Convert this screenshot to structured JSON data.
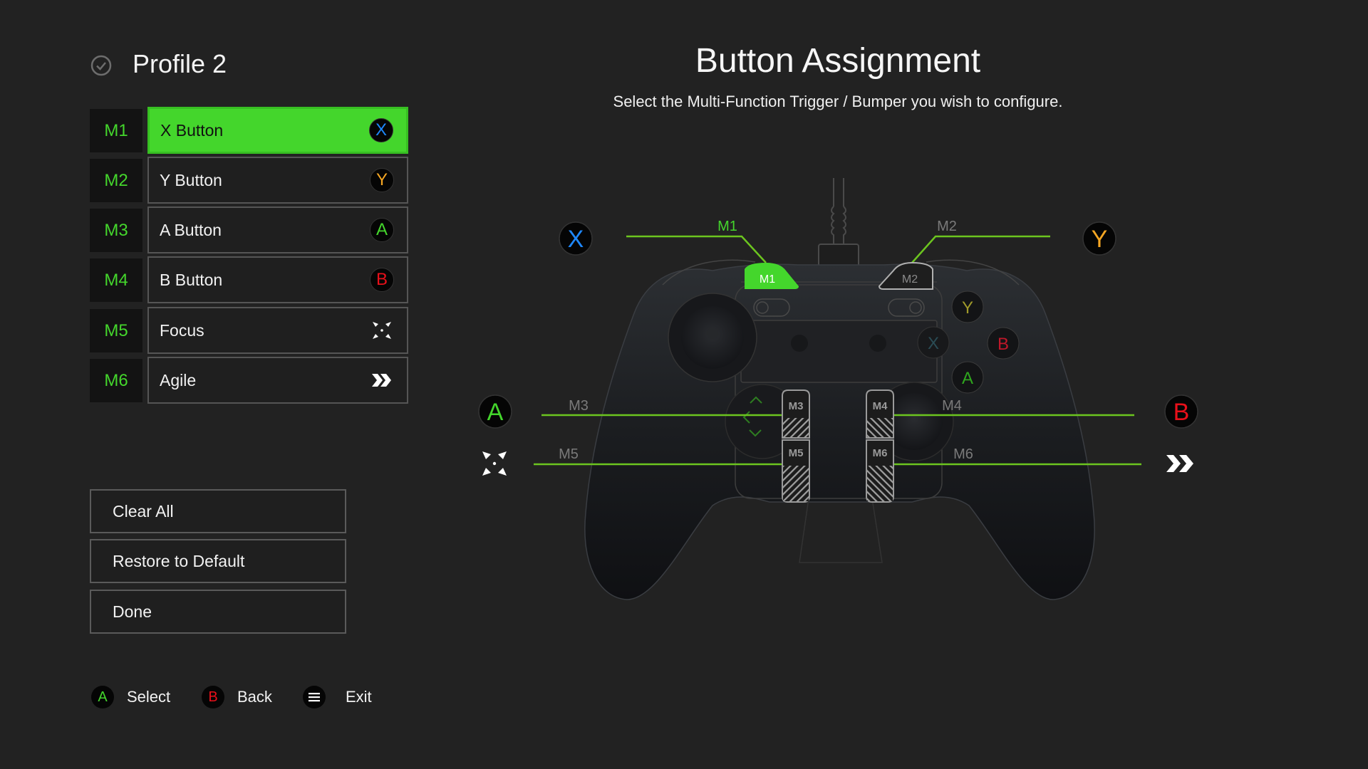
{
  "header": {
    "profile_name": "Profile 2",
    "status_icon": "check-circle-icon"
  },
  "mappings": [
    {
      "slot": "M1",
      "label": "X Button",
      "icon": "x-button-icon",
      "glyph": "X",
      "glyph_color": "#1e88ff",
      "selected": true
    },
    {
      "slot": "M2",
      "label": "Y Button",
      "icon": "y-button-icon",
      "glyph": "Y",
      "glyph_color": "#f5a623",
      "selected": false
    },
    {
      "slot": "M3",
      "label": "A Button",
      "icon": "a-button-icon",
      "glyph": "A",
      "glyph_color": "#44d62c",
      "selected": false
    },
    {
      "slot": "M4",
      "label": "B Button",
      "icon": "b-button-icon",
      "glyph": "B",
      "glyph_color": "#e8101a",
      "selected": false
    },
    {
      "slot": "M5",
      "label": "Focus",
      "icon": "focus-icon",
      "glyph": "",
      "glyph_color": "#ffffff",
      "selected": false
    },
    {
      "slot": "M6",
      "label": "Agile",
      "icon": "agile-icon",
      "glyph": "",
      "glyph_color": "#ffffff",
      "selected": false
    }
  ],
  "actions": {
    "clear_all": "Clear All",
    "restore_default": "Restore to Default",
    "done": "Done"
  },
  "footer": {
    "hints": [
      {
        "glyph": "A",
        "glyph_color": "#44d62c",
        "label": "Select"
      },
      {
        "glyph": "B",
        "glyph_color": "#e8101a",
        "label": "Back"
      },
      {
        "glyph": "menu",
        "glyph_color": "#ffffff",
        "label": "Exit"
      }
    ]
  },
  "main": {
    "title": "Button Assignment",
    "subtitle": "Select the Multi-Function Trigger / Bumper you wish to configure."
  },
  "diagram": {
    "active_slot": "M1",
    "callouts": {
      "M1": {
        "label": "M1",
        "assigned_glyph": "X"
      },
      "M2": {
        "label": "M2",
        "assigned_glyph": "Y"
      },
      "M3": {
        "label": "M3",
        "assigned_glyph": "A"
      },
      "M4": {
        "label": "M4",
        "assigned_glyph": "B"
      },
      "M5": {
        "label": "M5",
        "assigned_glyph": "focus"
      },
      "M6": {
        "label": "M6",
        "assigned_glyph": "agile"
      }
    },
    "face_buttons": {
      "Y": "Y",
      "B": "B",
      "A": "A",
      "X": "X"
    }
  },
  "colors": {
    "accent": "#44d62c",
    "background": "#222222",
    "callout_line": "#6cc51f",
    "x_blue": "#1e88ff",
    "y_yellow": "#f5a623",
    "a_green": "#44d62c",
    "b_red": "#e8101a"
  }
}
